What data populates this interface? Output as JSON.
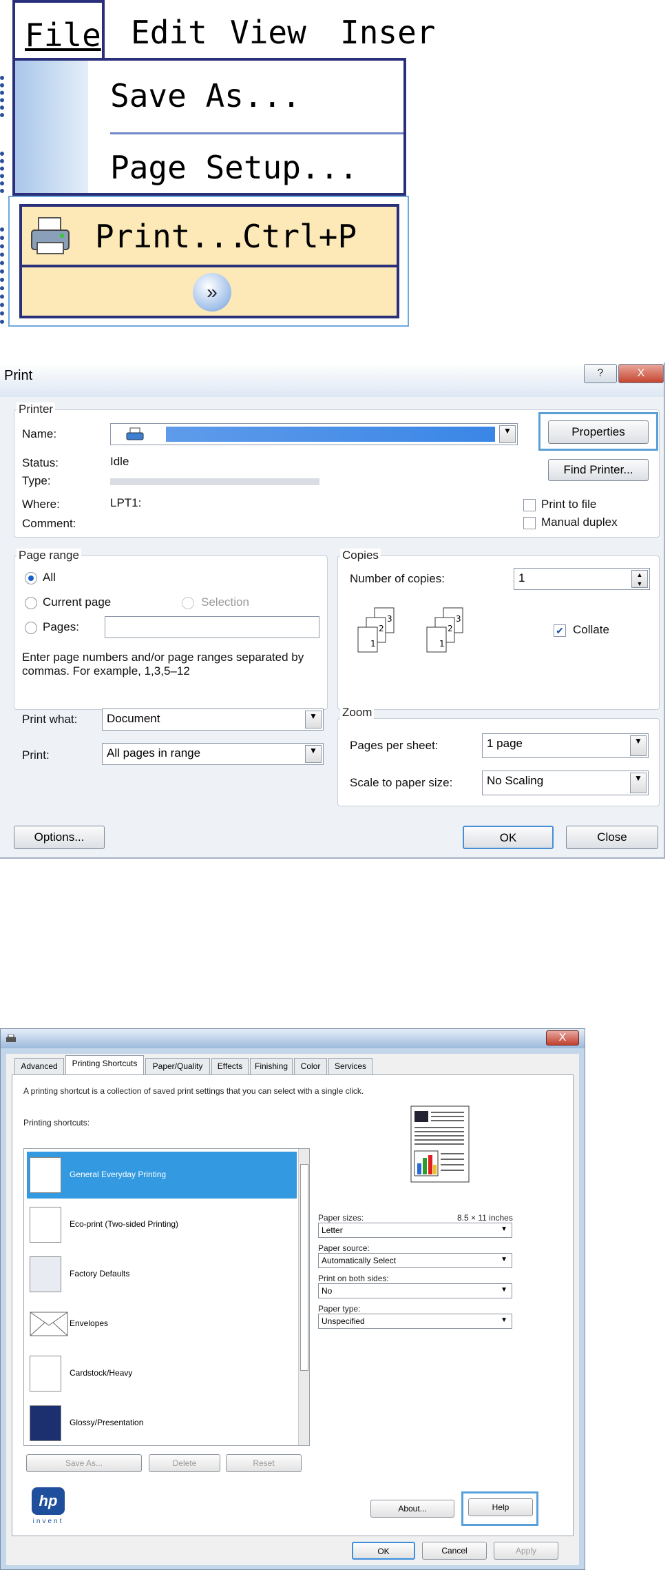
{
  "file_menu": {
    "menus": [
      "File",
      "Edit",
      "View",
      "Inser"
    ],
    "items": {
      "save_as": "Save As...",
      "page_setup": "Page Setup...",
      "print": "Print...",
      "print_shortcut": "Ctrl+P",
      "expand": "»"
    }
  },
  "print_dialog": {
    "title": "Print",
    "title_buttons": {
      "help": "?",
      "close": "X"
    },
    "printer": {
      "group": "Printer",
      "name_label": "Name:",
      "status_label": "Status:",
      "status_value": "Idle",
      "type_label": "Type:",
      "where_label": "Where:",
      "where_value": "LPT1:",
      "comment_label": "Comment:",
      "properties_button": "Properties",
      "find_printer_button": "Find Printer...",
      "print_to_file": "Print to file",
      "manual_duplex": "Manual duplex"
    },
    "page_range": {
      "group": "Page range",
      "all": "All",
      "current_page": "Current page",
      "selection": "Selection",
      "pages": "Pages:",
      "hint": "Enter page numbers and/or page ranges separated by commas. For example, 1,3,5–12"
    },
    "copies": {
      "group": "Copies",
      "number_label": "Number of copies:",
      "number_value": "1",
      "collate": "Collate"
    },
    "print_what_label": "Print what:",
    "print_what_value": "Document",
    "print_label": "Print:",
    "print_value": "All pages in range",
    "zoom": {
      "group": "Zoom",
      "pages_per_sheet_label": "Pages per sheet:",
      "pages_per_sheet_value": "1 page",
      "scale_label": "Scale to paper size:",
      "scale_value": "No Scaling"
    },
    "options_button": "Options...",
    "ok_button": "OK",
    "close_button": "Close"
  },
  "properties_dialog": {
    "close": "X",
    "tabs": [
      "Advanced",
      "Printing Shortcuts",
      "Paper/Quality",
      "Effects",
      "Finishing",
      "Color",
      "Services"
    ],
    "description": "A printing shortcut is a collection of saved print settings that you can select with a single click.",
    "shortcuts_label": "Printing shortcuts:",
    "shortcuts": [
      "General Everyday Printing",
      "Eco-print (Two-sided Printing)",
      "Factory Defaults",
      "Envelopes",
      "Cardstock/Heavy",
      "Glossy/Presentation"
    ],
    "paper_sizes_label": "Paper sizes:",
    "paper_sizes_dim": "8.5 × 11 inches",
    "paper_sizes_value": "Letter",
    "paper_source_label": "Paper source:",
    "paper_source_value": "Automatically Select",
    "both_sides_label": "Print on both sides:",
    "both_sides_value": "No",
    "paper_type_label": "Paper type:",
    "paper_type_value": "Unspecified",
    "save_as_button": "Save As...",
    "delete_button": "Delete",
    "reset_button": "Reset",
    "about_button": "About...",
    "help_button": "Help",
    "ok_button": "OK",
    "cancel_button": "Cancel",
    "apply_button": "Apply",
    "logo_text": "hp",
    "logo_sub": "invent"
  }
}
